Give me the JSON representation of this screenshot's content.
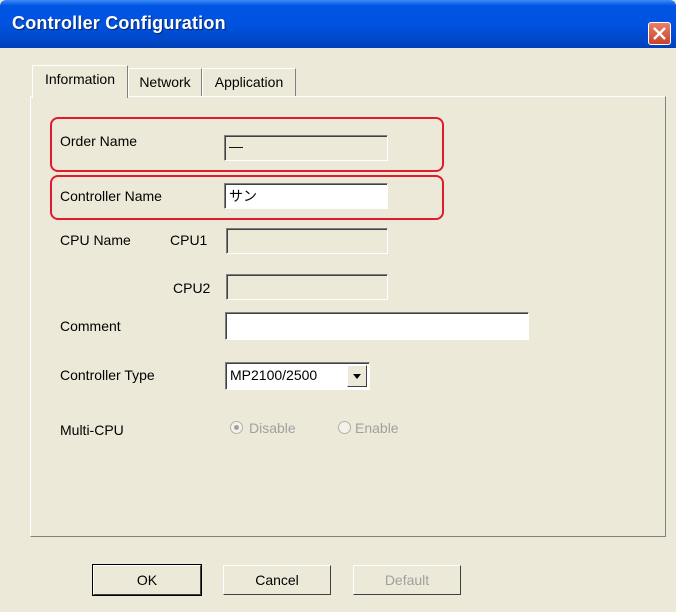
{
  "window": {
    "title": "Controller Configuration"
  },
  "tabs": [
    "Information",
    "Network",
    "Application"
  ],
  "fields": {
    "order_name": {
      "label": "Order Name",
      "value": "—"
    },
    "controller_name": {
      "label": "Controller Name",
      "value": "サン"
    },
    "cpu_name": {
      "label": "CPU Name",
      "cpu1_label": "CPU1",
      "cpu1_value": "",
      "cpu2_label": "CPU2",
      "cpu2_value": ""
    },
    "comment": {
      "label": "Comment",
      "value": ""
    },
    "controller_type": {
      "label": "Controller Type",
      "selected": "MP2100/2500"
    },
    "multi_cpu": {
      "label": "Multi-CPU",
      "options": [
        "Disable",
        "Enable"
      ],
      "selected": "Disable"
    }
  },
  "buttons": {
    "ok": "OK",
    "cancel": "Cancel",
    "default": "Default"
  },
  "colors": {
    "title_bar": "#0054E3",
    "highlight": "#E01C2C",
    "face": "#ECE9D8"
  }
}
